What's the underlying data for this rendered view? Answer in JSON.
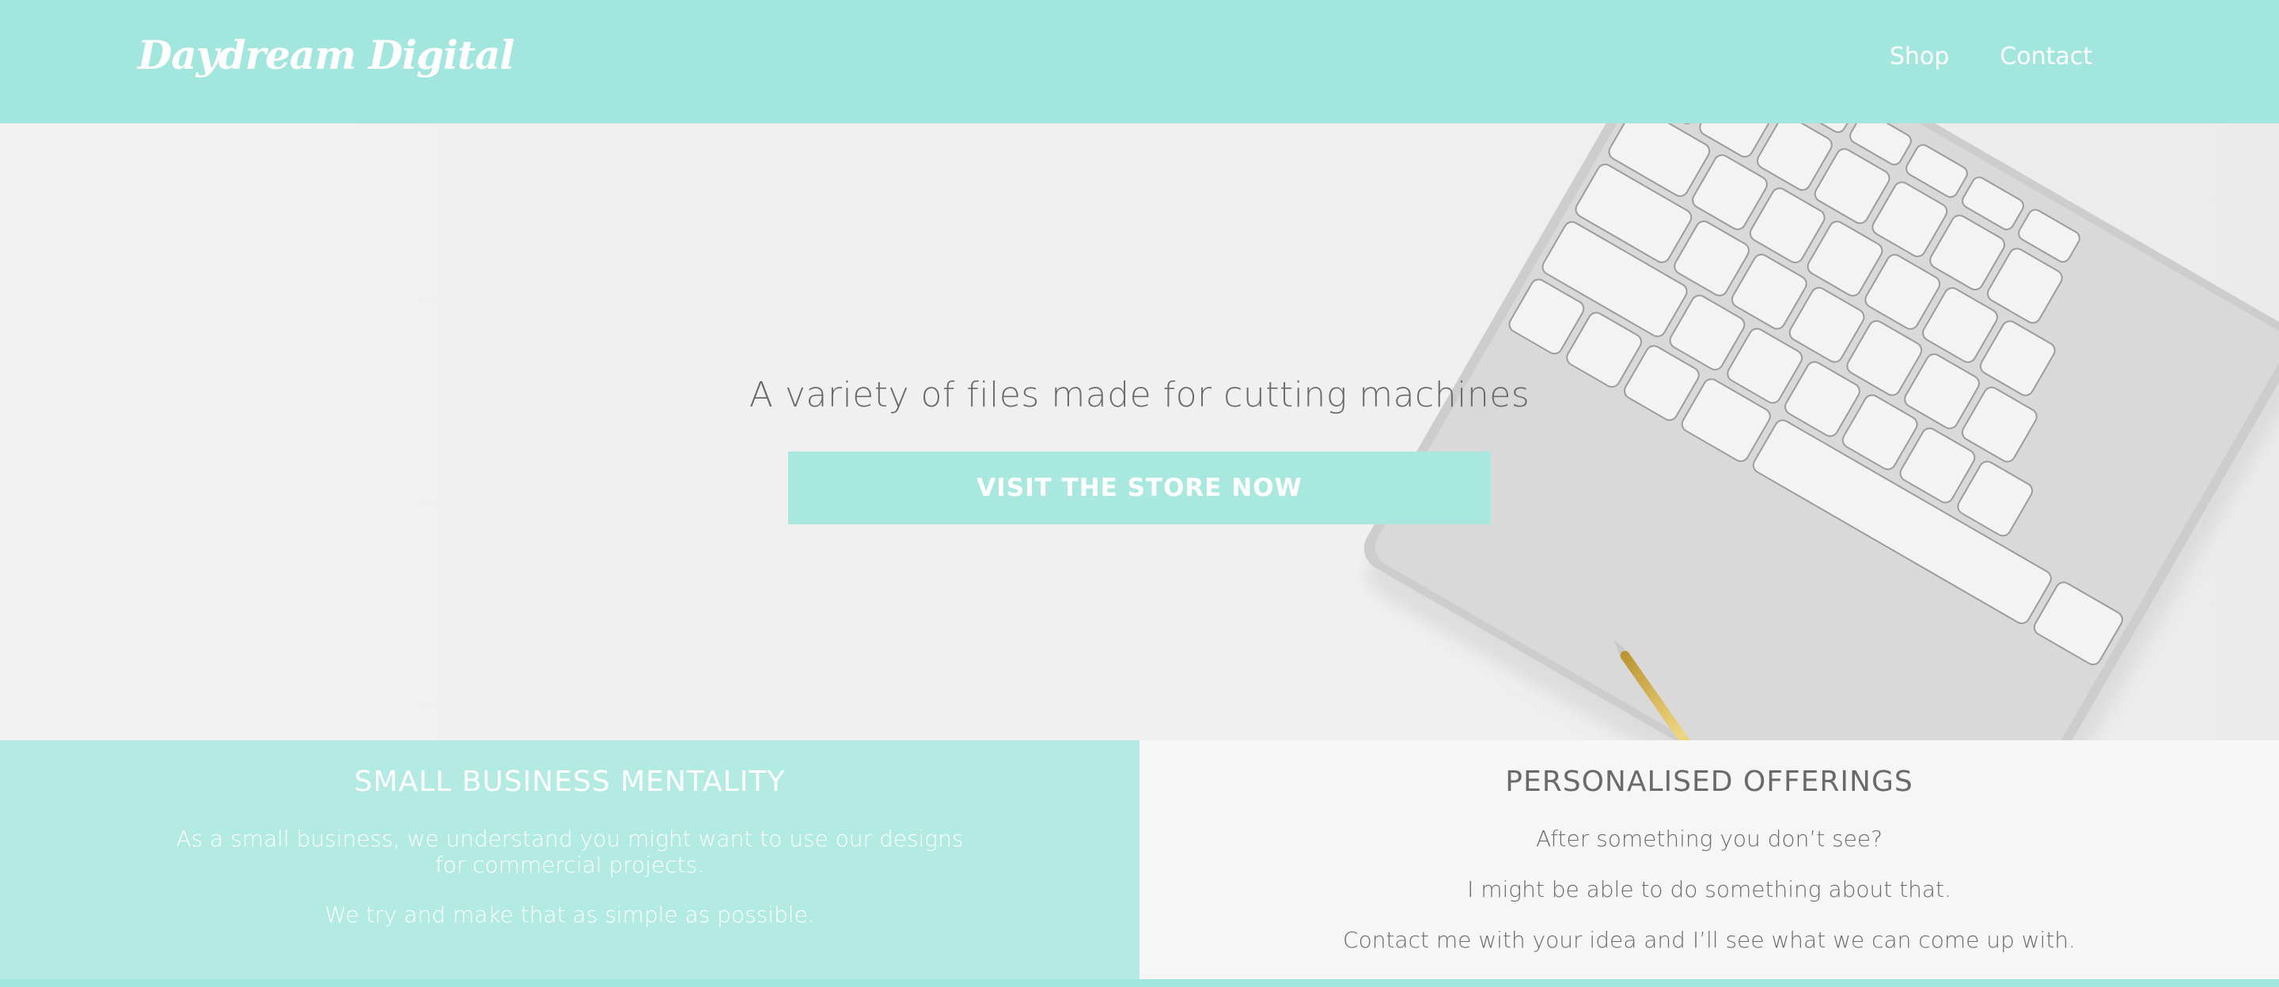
{
  "header": {
    "logo": "Daydream Digital",
    "nav": [
      {
        "label": "Shop"
      },
      {
        "label": "Contact"
      }
    ]
  },
  "hero": {
    "title": "A variety of files made for cutting machines",
    "cta_label": "VISIT THE STORE NOW"
  },
  "features": {
    "left": {
      "heading": "SMALL BUSINESS MENTALITY",
      "paragraphs": [
        "As a small business, we understand you might want to use our designs for commercial projects.",
        "We try and make that as simple as possible."
      ]
    },
    "right": {
      "heading": "PERSONALISED OFFERINGS",
      "paragraphs": [
        "After something you don’t see?",
        "I might be able to do something about that.",
        "Contact me with your idea and I’ll see what we can come up with."
      ]
    }
  },
  "colors": {
    "brand": "#a2e6de",
    "cta": "#a8e8df",
    "text_gray": "#6a6a6a"
  }
}
